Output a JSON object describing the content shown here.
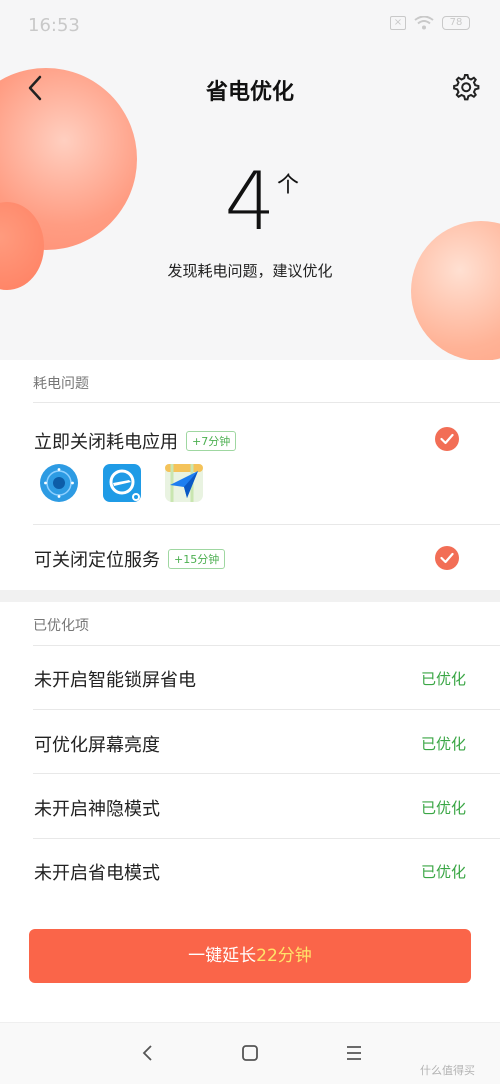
{
  "status_bar": {
    "time": "16:53",
    "x_icon": "x-box-icon",
    "battery_level": "78"
  },
  "header": {
    "title": "省电优化"
  },
  "summary": {
    "count": "4",
    "unit": "个",
    "message": "发现耗电问题，建议优化"
  },
  "issues": {
    "heading": "耗电问题",
    "items": [
      {
        "label": "立即关闭耗电应用",
        "tag": "+7分钟",
        "checked": true,
        "apps": [
          "remote-control-app-icon",
          "flight-app-icon",
          "maps-app-icon"
        ]
      },
      {
        "label": "可关闭定位服务",
        "tag": "+15分钟",
        "checked": true
      }
    ]
  },
  "optimized": {
    "heading": "已优化项",
    "items": [
      {
        "label": "未开启智能锁屏省电",
        "status": "已优化"
      },
      {
        "label": "可优化屏幕亮度",
        "status": "已优化"
      },
      {
        "label": "未开启神隐模式",
        "status": "已优化"
      },
      {
        "label": "未开启省电模式",
        "status": "已优化"
      }
    ]
  },
  "action": {
    "prefix": "一键延长",
    "highlight": "22分钟"
  },
  "watermark": "什么值得买",
  "colors": {
    "accent": "#fa6549",
    "check": "#f26e56",
    "ok_green": "#3aa645",
    "highlight": "#ffe36a"
  }
}
